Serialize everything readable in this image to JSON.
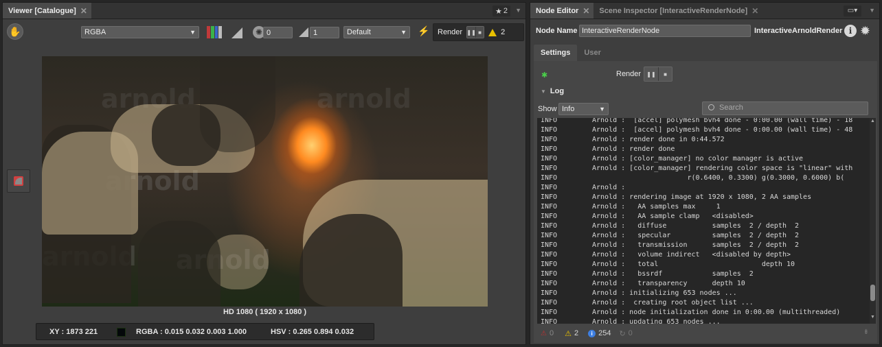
{
  "viewer": {
    "tab_title": "Viewer [Catalogue]",
    "star_count": "2",
    "channel_select": "RGBA",
    "exposure": "0",
    "gamma": "1",
    "display_select": "Default",
    "render_label": "Render",
    "warning_count": "2",
    "image_caption": "HD 1080 ( 1920 x 1080 )",
    "status": {
      "xy": "XY : 1873 221",
      "rgba": "RGBA : 0.015 0.032 0.003 1.000",
      "hsv": "HSV : 0.265 0.894 0.032",
      "swatch_color": "#04080a"
    },
    "watermark": "arnold"
  },
  "node_editor": {
    "tabs": [
      {
        "label": "Node Editor",
        "active": true
      },
      {
        "label": "Scene Inspector [InteractiveRenderNode]",
        "active": false
      }
    ],
    "node_name_label": "Node Name",
    "node_name_value": "InteractiveRenderNode",
    "node_type": "InteractiveArnoldRender",
    "subtabs": [
      "Settings",
      "User"
    ],
    "render_label": "Render",
    "log_label": "Log",
    "show_label": "Show",
    "show_select": "Info",
    "search_placeholder": "Search",
    "log_lines": [
      {
        "level": "INFO",
        "text": "Arnold :  [accel] polymesh bvh4 done - 0:00.00 (wall time) - 18"
      },
      {
        "level": "INFO",
        "text": "Arnold :  [accel] polymesh bvh4 done - 0:00.00 (wall time) - 48"
      },
      {
        "level": "INFO",
        "text": "Arnold : render done in 0:44.572"
      },
      {
        "level": "INFO",
        "text": "Arnold : render done"
      },
      {
        "level": "INFO",
        "text": "Arnold : [color_manager] no color manager is active"
      },
      {
        "level": "INFO",
        "text": "Arnold : [color_manager] rendering color space is \"linear\" with"
      },
      {
        "level": "INFO",
        "text": "                       r(0.6400, 0.3300) g(0.3000, 0.6000) b("
      },
      {
        "level": "INFO",
        "text": "Arnold :"
      },
      {
        "level": "INFO",
        "text": "Arnold : rendering image at 1920 x 1080, 2 AA samples"
      },
      {
        "level": "INFO",
        "text": "Arnold :   AA samples max     1"
      },
      {
        "level": "INFO",
        "text": "Arnold :   AA sample clamp   <disabled>"
      },
      {
        "level": "INFO",
        "text": "Arnold :   diffuse           samples  2 / depth  2"
      },
      {
        "level": "INFO",
        "text": "Arnold :   specular          samples  2 / depth  2"
      },
      {
        "level": "INFO",
        "text": "Arnold :   transmission      samples  2 / depth  2"
      },
      {
        "level": "INFO",
        "text": "Arnold :   volume indirect   <disabled by depth>"
      },
      {
        "level": "INFO",
        "text": "Arnold :   total                         depth 10"
      },
      {
        "level": "INFO",
        "text": "Arnold :   bssrdf            samples  2"
      },
      {
        "level": "INFO",
        "text": "Arnold :   transparency      depth 10"
      },
      {
        "level": "INFO",
        "text": "Arnold : initializing 653 nodes ..."
      },
      {
        "level": "INFO",
        "text": "Arnold :  creating root object list ..."
      },
      {
        "level": "INFO",
        "text": "Arnold : node initialization done in 0:00.00 (multithreaded)"
      },
      {
        "level": "INFO",
        "text": "Arnold : updating 653 nodes ..."
      }
    ],
    "counts": {
      "errors": "0",
      "warnings": "2",
      "info": "254",
      "debug": "0"
    }
  }
}
